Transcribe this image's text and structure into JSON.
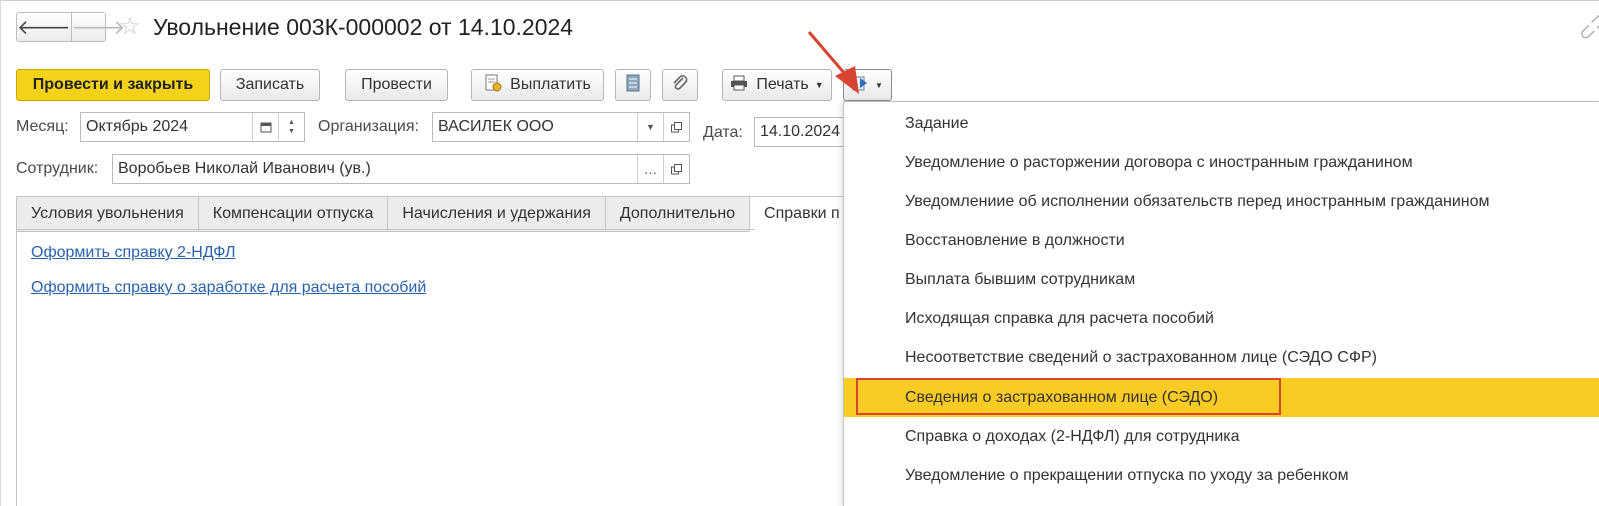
{
  "window": {
    "title": "Увольнение 003К-000002 от 14.10.2024"
  },
  "colors": {
    "primary_button": "#f4d21a",
    "selected_menu_item": "#f9cb23",
    "link": "#2a63ad",
    "annotation": "#d94430"
  },
  "icons": {
    "back": "arrow-left-icon",
    "forward": "arrow-right-icon",
    "favorite": "star-icon",
    "link": "link-icon",
    "pay": "payment-document-icon",
    "report": "report-list-icon",
    "attach": "paperclip-icon",
    "print": "printer-icon",
    "create_based": "create-based-on-icon"
  },
  "toolbar": {
    "post_close": "Провести и закрыть",
    "save": "Записать",
    "post": "Провести",
    "pay": "Выплатить",
    "print": "Печать"
  },
  "fields": {
    "month_label": "Месяц:",
    "month_value": "Октябрь 2024",
    "org_label": "Организация:",
    "org_value": "ВАСИЛЕК ООО",
    "date_label": "Дата:",
    "date_value": "14.10.2024",
    "employee_label": "Сотрудник:",
    "employee_value": "Воробьев Николай Иванович (ув.)"
  },
  "tabs": [
    {
      "label": "Условия увольнения"
    },
    {
      "label": "Компенсации отпуска"
    },
    {
      "label": "Начисления и удержания"
    },
    {
      "label": "Дополнительно"
    },
    {
      "label": "Справки п"
    }
  ],
  "links": [
    {
      "label": "Оформить справку 2-НДФЛ"
    },
    {
      "label": "Оформить справку о заработке для расчета пособий"
    }
  ],
  "menu": {
    "items": [
      {
        "label": "Задание"
      },
      {
        "label": "Уведомление о расторжении договора с иностранным гражданином"
      },
      {
        "label": "Уведомлениие об исполнении обязательств перед иностранным гражданином"
      },
      {
        "label": "Восстановление в должности"
      },
      {
        "label": "Выплата бывшим сотрудникам"
      },
      {
        "label": "Исходящая справка для расчета пособий"
      },
      {
        "label": "Несоответствие сведений о застрахованном лице (СЭДО СФР)"
      },
      {
        "label": "Сведения о застрахованном лице (СЭДО)",
        "selected": true
      },
      {
        "label": "Справка о доходах (2-НДФЛ) для сотрудника"
      },
      {
        "label": "Уведомление о прекращении отпуска по уходу за ребенком"
      }
    ]
  }
}
